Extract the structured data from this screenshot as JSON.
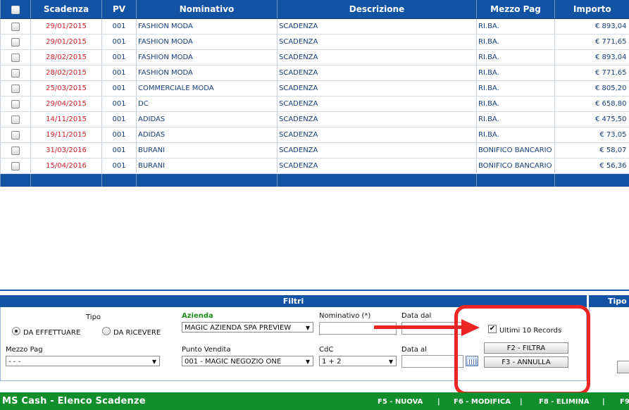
{
  "grid": {
    "columns": [
      "Scadenza",
      "PV",
      "Nominativo",
      "Descrizione",
      "Mezzo Pag",
      "Importo"
    ],
    "rows": [
      {
        "date": "29/01/2015",
        "pv": "001",
        "name": "FASHION MODA",
        "desc": "SCADENZA",
        "pay": "RI.BA.",
        "amount": "€ 893,04"
      },
      {
        "date": "29/01/2015",
        "pv": "001",
        "name": "FASHION MODA",
        "desc": "SCADENZA",
        "pay": "RI.BA.",
        "amount": "€ 771,65"
      },
      {
        "date": "28/02/2015",
        "pv": "001",
        "name": "FASHION MODA",
        "desc": "SCADENZA",
        "pay": "RI.BA.",
        "amount": "€ 893,04"
      },
      {
        "date": "28/02/2015",
        "pv": "001",
        "name": "FASHION MODA",
        "desc": "SCADENZA",
        "pay": "RI.BA.",
        "amount": "€ 771,65"
      },
      {
        "date": "25/03/2015",
        "pv": "001",
        "name": "COMMERCIALE MODA",
        "desc": "SCADENZA",
        "pay": "RI.BA.",
        "amount": "€ 805,20"
      },
      {
        "date": "29/04/2015",
        "pv": "001",
        "name": "DC",
        "desc": "SCADENZA",
        "pay": "RI.BA.",
        "amount": "€ 658,80"
      },
      {
        "date": "14/11/2015",
        "pv": "001",
        "name": "ADIDAS",
        "desc": "SCADENZA",
        "pay": "RI.BA.",
        "amount": "€ 475,50"
      },
      {
        "date": "19/11/2015",
        "pv": "001",
        "name": "ADIDAS",
        "desc": "SCADENZA",
        "pay": "RI.BA.",
        "amount": "€ 73,05"
      },
      {
        "date": "31/03/2016",
        "pv": "001",
        "name": "BURANI",
        "desc": "SCADENZA",
        "pay": "BONIFICO BANCARIO",
        "amount": "€ 58,07"
      },
      {
        "date": "15/04/2016",
        "pv": "001",
        "name": "BURANI",
        "desc": "SCADENZA",
        "pay": "BONIFICO BANCARIO",
        "amount": "€ 56,36"
      }
    ]
  },
  "filters": {
    "section_title": "Filtri",
    "side_title": "Tipo",
    "tipo_label": "Tipo",
    "radio_effettuare": "DA EFFETTUARE",
    "radio_ricevere": "DA RICEVERE",
    "azienda_label": "Azienda",
    "azienda_value": "MAGIC AZIENDA SPA PREVIEW",
    "nominativo_label": "Nominativo (*)",
    "data_dal_label": "Data dal",
    "ultimi_label": "Ultimi 10 Records",
    "mezzo_label": "Mezzo Pag",
    "mezzo_value": "- - -",
    "pv_label": "Punto Vendita",
    "pv_value": "001 - MAGIC NEGOZIO ONE",
    "cdc_label": "CdC",
    "cdc_value": "1 + 2",
    "data_al_label": "Data al",
    "btn_filtra": "F2 - FILTRA",
    "btn_annulla": "F3 - ANNULLA"
  },
  "status": {
    "title": "MS Cash - Elenco Scadenze",
    "f5": "F5 - NUOVA",
    "f6": "F6 - MODIFICA",
    "f8": "F8 - ELIMINA",
    "f9": "F9",
    "separator": "|"
  },
  "colors": {
    "header_blue": "#1254a3",
    "status_green": "#108e2c",
    "date_red": "#d8202a",
    "highlight": "#ee2525"
  }
}
